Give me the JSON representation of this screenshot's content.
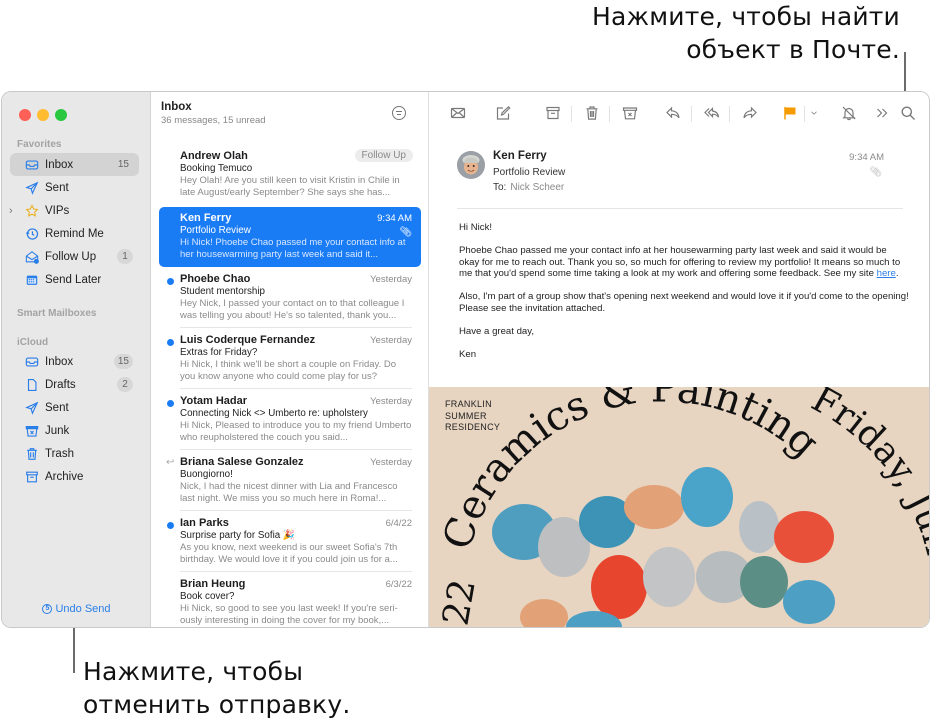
{
  "callouts": {
    "search": "Нажмите, чтобы найти\nобъект в Почте.",
    "search_line1": "Нажмите, чтобы найти",
    "search_line2": "объект в Почте.",
    "undo_line1": "Нажмите, чтобы",
    "undo_line2": "отменить отправку."
  },
  "sidebar": {
    "favorites_label": "Favorites",
    "favorites": [
      {
        "label": "Inbox",
        "icon": "inbox-icon",
        "badge": "15",
        "active": true
      },
      {
        "label": "Sent",
        "icon": "paper-plane-icon",
        "badge": ""
      },
      {
        "label": "VIPs",
        "icon": "star-icon",
        "badge": ""
      },
      {
        "label": "Remind Me",
        "icon": "clock-icon",
        "badge": ""
      },
      {
        "label": "Follow Up",
        "icon": "follow-up-icon",
        "badge": "1"
      },
      {
        "label": "Send Later",
        "icon": "calendar-icon",
        "badge": ""
      }
    ],
    "smart_label": "Smart Mailboxes",
    "icloud_label": "iCloud",
    "icloud": [
      {
        "label": "Inbox",
        "icon": "inbox-icon",
        "badge": "15"
      },
      {
        "label": "Drafts",
        "icon": "document-icon",
        "badge": "2"
      },
      {
        "label": "Sent",
        "icon": "paper-plane-icon",
        "badge": ""
      },
      {
        "label": "Junk",
        "icon": "junk-icon",
        "badge": ""
      },
      {
        "label": "Trash",
        "icon": "trash-icon",
        "badge": ""
      },
      {
        "label": "Archive",
        "icon": "archive-icon",
        "badge": ""
      }
    ],
    "undo_send": "Undo Send"
  },
  "list": {
    "title": "Inbox",
    "subtitle": "36 messages, 15 unread",
    "messages": [
      {
        "from": "Andrew Olah",
        "date": "",
        "tag": "Follow Up",
        "subject": "Booking Temuco",
        "preview": "Hey Olah! Are you still keen to visit Kristin in Chile in late August/early September? She says she has...",
        "unread": false
      },
      {
        "from": "Ken Ferry",
        "date": "9:34 AM",
        "subject": "Portfolio Review",
        "preview": "Hi Nick! Phoebe Chao passed me your contact info at her housewarming party last week and said it...",
        "selected": true,
        "attachment": true
      },
      {
        "from": "Phoebe Chao",
        "date": "Yesterday",
        "subject": "Student mentorship",
        "preview": "Hey Nick, I passed your contact on to that colleague I was telling you about! He's so talented, thank you...",
        "unread": true
      },
      {
        "from": "Luis Coderque Fernandez",
        "date": "Yesterday",
        "subject": "Extras for Friday?",
        "preview": "Hi Nick, I think we'll be short a couple on Friday. Do you know anyone who could come play for us?",
        "unread": true
      },
      {
        "from": "Yotam Hadar",
        "date": "Yesterday",
        "subject": "Connecting Nick <> Umberto re: upholstery",
        "preview": "Hi Nick, Pleased to introduce you to my friend Umberto who reupholstered the couch you said...",
        "unread": true
      },
      {
        "from": "Briana Salese Gonzalez",
        "date": "Yesterday",
        "subject": "Buongiorno!",
        "preview": "Nick, I had the nicest dinner with Lia and Francesco last night. We miss you so much here in Roma!...",
        "replied": true
      },
      {
        "from": "Ian Parks",
        "date": "6/4/22",
        "subject": "Surprise party for Sofia 🎉",
        "preview": "As you know, next weekend is our sweet Sofia's 7th birthday. We would love it if you could join us for a...",
        "unread": true
      },
      {
        "from": "Brian Heung",
        "date": "6/3/22",
        "subject": "Book cover?",
        "preview": "Hi Nick, so good to see you last week! If you're seri-ously interesting in doing the cover for my book,...",
        "unread": false
      }
    ]
  },
  "toolbar": {
    "items": [
      "envelope-icon",
      "compose-icon",
      "archive-icon",
      "trash-icon",
      "junk-icon",
      "reply-icon",
      "reply-all-icon",
      "forward-icon",
      "flag-icon",
      "flag-menu-chevron-icon",
      "mute-bell-icon",
      "more-chevron-icon",
      "search-icon"
    ],
    "flag_color": "#f59b00"
  },
  "viewer": {
    "from": "Ken Ferry",
    "subject": "Portfolio Review",
    "to_label": "To:",
    "to": "Nick Scheer",
    "time": "9:34 AM",
    "greeting": "Hi Nick!",
    "para1": "Phoebe Chao passed me your contact info at her housewarming party last week and said it would be okay for me to reach out. Thank you so, so much for offering to review my portfolio! It means so much to me that you'd spend some time taking a look at my work and offering some feedback. See my site ",
    "link": "here",
    "para1_end": ".",
    "para2": "Also, I'm part of a group show that's opening next weekend and would love it if you'd come to the opening! Please see the invitation attached.",
    "signoff": "Have a great day,",
    "signature": "Ken",
    "poster": {
      "label_lines": [
        "FRANKLIN",
        "SUMMER",
        "RESIDENCY"
      ],
      "arc_text": "Ceramics & Painting",
      "right_text": "Friday, June",
      "left_text": "22"
    }
  },
  "colors": {
    "accent": "#1a7cf5",
    "sidebar_bg": "#e8e8e8",
    "poster_bg": "#e7d4c1"
  }
}
